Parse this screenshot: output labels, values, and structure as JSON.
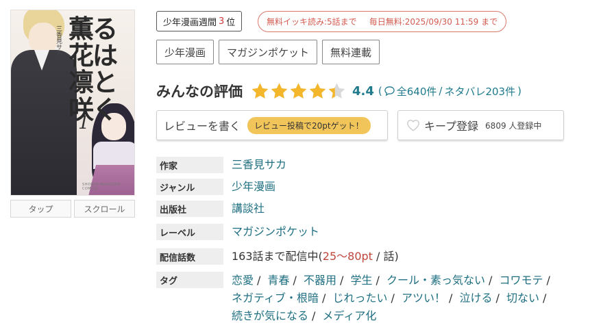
{
  "cover": {
    "title_lines": [
      "薫る",
      "花は",
      "凛と",
      "咲く"
    ],
    "author_vertical": "三香見サカ",
    "volume": "1",
    "imprint": "SHONEN MAGAZINE COMICS"
  },
  "view_modes": {
    "tap": "タップ",
    "scroll": "スクロール"
  },
  "ranking": {
    "prefix": "少年漫画週間",
    "rank": "3",
    "suffix": "位"
  },
  "free_offer": {
    "binge": "無料イッキ読み:5話まで",
    "daily": "毎日無料:2025/09/30 11:59 まで"
  },
  "category_chips": [
    "少年漫画",
    "マガジンポケット",
    "無料連載"
  ],
  "rating": {
    "title": "みんなの評価",
    "score": "4.4",
    "score_value": 4.4,
    "stars_max": 5,
    "open_paren": "(",
    "reviews": "全640件",
    "sep": "/",
    "spoilers": "ネタバレ203件",
    "close_paren": ")"
  },
  "review_button": {
    "label": "レビューを書く",
    "promo": "レビュー投稿で20ptゲット！"
  },
  "keep_button": {
    "label": "キープ登録",
    "count": "6809 人登録中"
  },
  "info": {
    "author_label": "作家",
    "author": "三香見サカ",
    "genre_label": "ジャンル",
    "genre": "少年漫画",
    "publisher_label": "出版社",
    "publisher": "講談社",
    "label_label": "レーベル",
    "label": "マガジンポケット",
    "episodes_label": "配信話数",
    "episodes_prefix": "163話まで配信中(",
    "episodes_price": "25〜80pt",
    "episodes_suffix": " / 話)",
    "tags_label": "タグ",
    "tags": [
      "恋愛",
      "青春",
      "不器用",
      "学生",
      "クール・素っ気ない",
      "コワモテ",
      "ネガティブ・根暗",
      "じれったい",
      "アツい！",
      "泣ける",
      "切ない",
      "続きが気になる",
      "メディア化"
    ]
  },
  "colors": {
    "accent_teal": "#1f7a8c",
    "star": "#f4b62a",
    "promo": "#f2c55b",
    "alert": "#d45b50"
  }
}
